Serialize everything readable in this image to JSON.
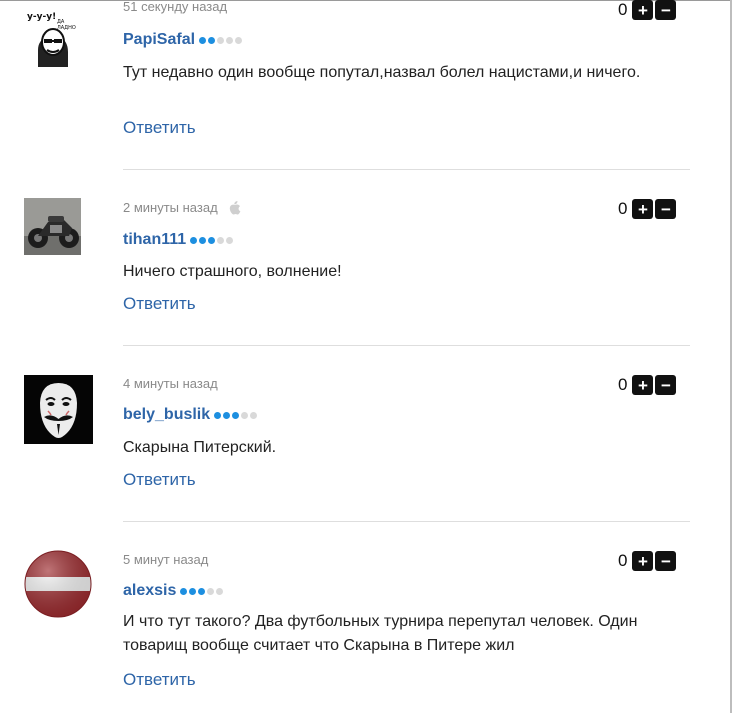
{
  "comments": [
    {
      "time": "51 секунду назад",
      "author": "PapiSafal",
      "rating": [
        true,
        true,
        false,
        false,
        false
      ],
      "text": "Тут недавно один вообще попутал,назвал болел нацистами,и ничего.",
      "reply": "Ответить",
      "score": "0",
      "avatar": "meme-face-avatar",
      "avatar_text": "У-у-у! ДА ЛАДНО!"
    },
    {
      "time": "2 минуты назад",
      "device_icon": "apple-icon",
      "author": "tihan111",
      "rating": [
        true,
        true,
        true,
        false,
        false
      ],
      "text": "Ничего страшного, волнение!",
      "reply": "Ответить",
      "score": "0",
      "avatar": "motorcycle-avatar"
    },
    {
      "time": "4 минуты назад",
      "author": "bely_buslik",
      "rating": [
        true,
        true,
        true,
        false,
        false
      ],
      "text": "Скарына Питерский.",
      "reply": "Ответить",
      "score": "0",
      "avatar": "guy-fawkes-mask-avatar"
    },
    {
      "time": "5 минут назад",
      "author": "alexsis",
      "rating": [
        true,
        true,
        true,
        false,
        false
      ],
      "text": "И что тут такого? Два футбольных турнира перепутал человек. Один товарищ вообще считает что Скарына в Питере жил",
      "reply": "Ответить",
      "score": "0",
      "avatar": "latvia-flag-avatar"
    }
  ],
  "vote_buttons": {
    "plus": "+",
    "minus": "−"
  },
  "colors": {
    "link": "#2e65a8",
    "dot_on": "#1d8fe0",
    "dot_off": "#d9d9d9",
    "separator": "#dedede"
  }
}
